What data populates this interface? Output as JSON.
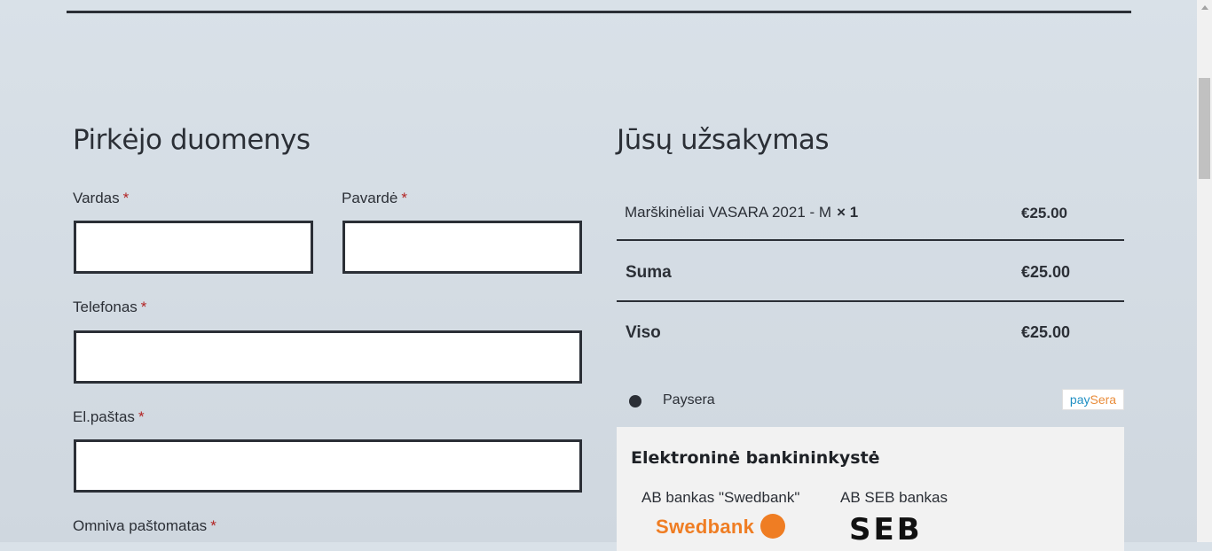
{
  "billing": {
    "title": "Pirkėjo duomenys",
    "fields": {
      "first_name": {
        "label": "Vardas",
        "required": "*",
        "value": ""
      },
      "last_name": {
        "label": "Pavardė",
        "required": "*",
        "value": ""
      },
      "phone": {
        "label": "Telefonas",
        "required": "*",
        "value": ""
      },
      "email": {
        "label": "El.paštas",
        "required": "*",
        "value": ""
      },
      "omniva": {
        "label": "Omniva paštomatas",
        "required": "*"
      }
    }
  },
  "order": {
    "title": "Jūsų užsakymas",
    "item": {
      "name": "Marškinėliai VASARA 2021 - M",
      "qty": "× 1",
      "price": "€25.00"
    },
    "subtotal": {
      "label": "Suma",
      "value": "€25.00"
    },
    "total": {
      "label": "Viso",
      "value": "€25.00"
    }
  },
  "payment": {
    "method_label": "Paysera",
    "logo_text_a": "pay",
    "logo_text_b": "Sera",
    "bank_section_title": "Elektroninė bankininkystė",
    "banks": [
      {
        "name": "AB bankas \"Swedbank\"",
        "logo_text": "Swedbank"
      },
      {
        "name": "AB SEB bankas",
        "logo_text": "SEB"
      }
    ]
  },
  "colors": {
    "accent_required": "#b22222",
    "swedbank_orange": "#ef7d23",
    "paysera_blue": "#1f8fc3"
  }
}
